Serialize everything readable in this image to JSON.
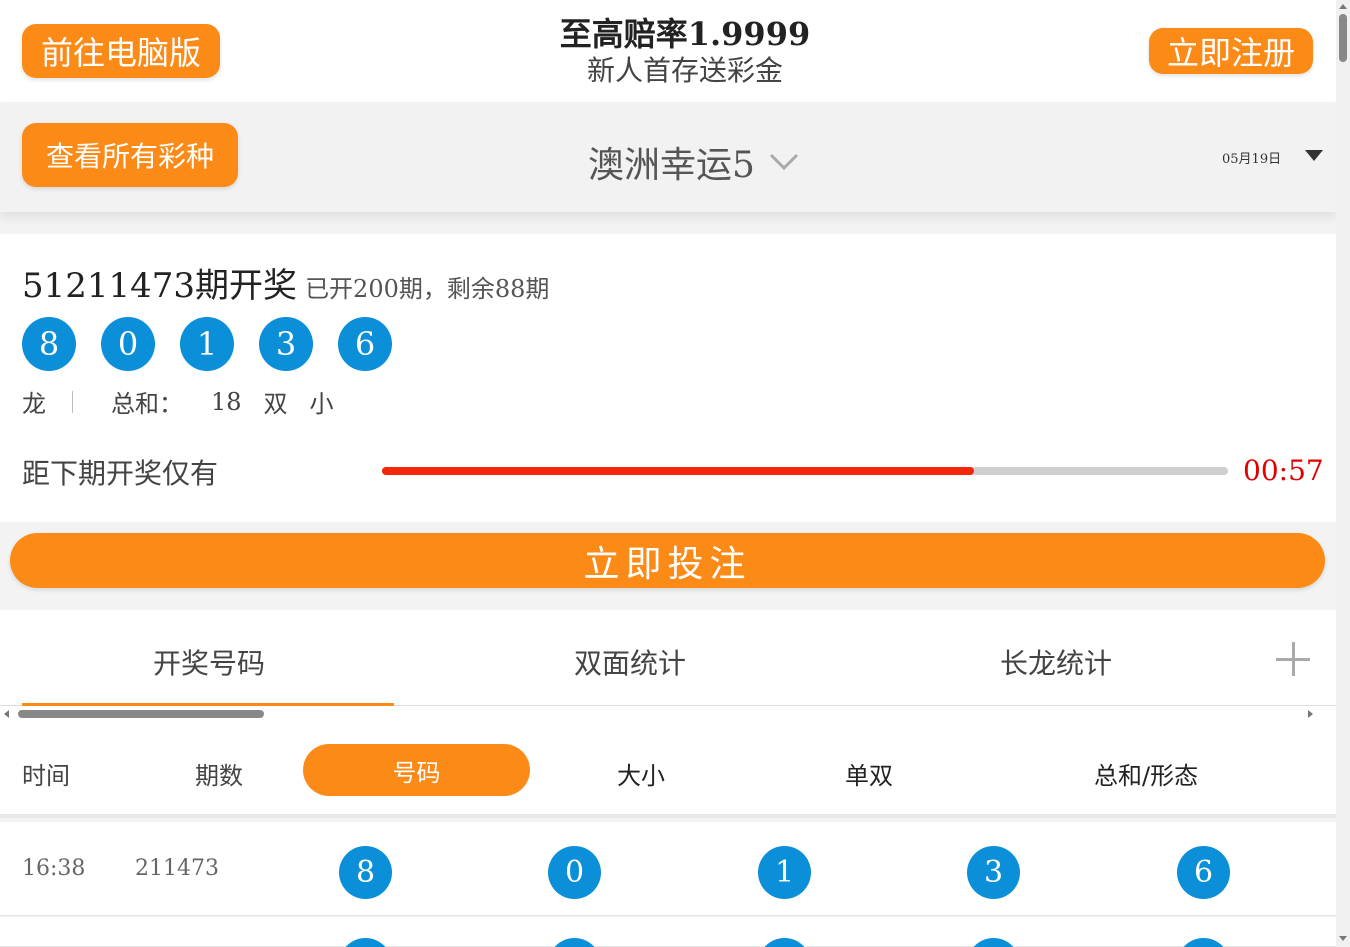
{
  "header": {
    "pc_button": "前往电脑版",
    "promo_title": "至高赔率1.9999",
    "promo_subtitle": "新人首存送彩金",
    "register_button": "立即注册"
  },
  "selector": {
    "all_lotteries_button": "查看所有彩种",
    "lottery_name": "澳洲幸运5",
    "date": "05月19日"
  },
  "draw": {
    "issue_title": "51211473期开奖",
    "issue_info": "已开200期，剩余88期",
    "balls": [
      "8",
      "0",
      "1",
      "3",
      "6"
    ],
    "dragon_tiger": "龙",
    "sum_label": "总和：",
    "sum_value": "18",
    "odd_even": "双",
    "big_small": "小",
    "countdown_label": "距下期开奖仅有",
    "countdown_time": "00:57",
    "countdown_progress": 0.7
  },
  "bet_button": "立即投注",
  "tabs": [
    "开奖号码",
    "双面统计",
    "长龙统计"
  ],
  "table": {
    "headers": [
      "时间",
      "期数",
      "号码",
      "大小",
      "单双",
      "总和/形态"
    ],
    "rows": [
      {
        "time": "16:38",
        "issue": "211473",
        "balls": [
          "8",
          "0",
          "1",
          "3",
          "6"
        ]
      }
    ]
  },
  "colors": {
    "accent": "#fb8a17",
    "ball": "#0a8fd8",
    "progress": "#f5270a",
    "countdown": "#e00000"
  }
}
